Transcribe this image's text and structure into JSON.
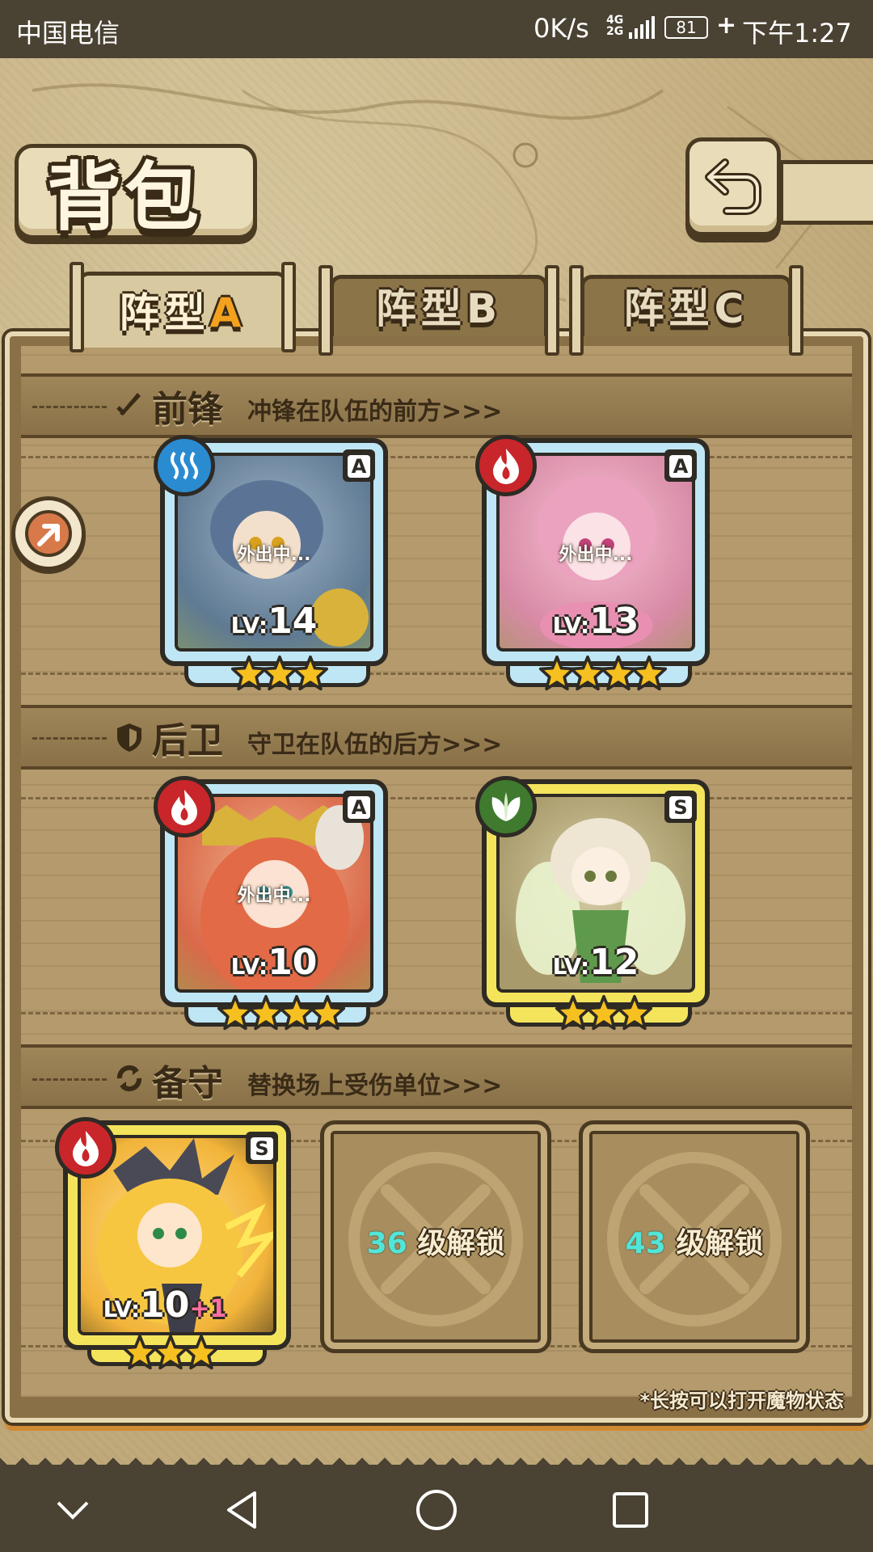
{
  "status_bar": {
    "carrier": "中国电信",
    "speed": "0K/s",
    "network": "4G\n2G",
    "battery": "81",
    "time": "下午1:27"
  },
  "header": {
    "title": "背包",
    "back_icon": "return-arrow-icon"
  },
  "tabs": [
    {
      "prefix": "阵型",
      "letter": "A",
      "active": true
    },
    {
      "prefix": "阵型",
      "letter": "B",
      "active": false
    },
    {
      "prefix": "阵型",
      "letter": "C",
      "active": false
    }
  ],
  "sections": {
    "front": {
      "title": "前锋",
      "subtitle": "冲锋在队伍的前方>>>",
      "icon": "sword-icon"
    },
    "back": {
      "title": "后卫",
      "subtitle": "守卫在队伍的后方>>>",
      "icon": "shield-icon"
    },
    "reserve": {
      "title": "备守",
      "subtitle": "替换场上受伤单位>>>",
      "icon": "swap-icon"
    }
  },
  "cards": {
    "front_1": {
      "element": "water",
      "rank": "A",
      "away": "外出中...",
      "lv_prefix": "LV:",
      "lv": "14",
      "stars": 3,
      "frame": "blue"
    },
    "front_2": {
      "element": "fire",
      "rank": "A",
      "away": "外出中...",
      "lv_prefix": "LV:",
      "lv": "13",
      "stars": 4,
      "frame": "blue"
    },
    "back_1": {
      "element": "fire",
      "rank": "A",
      "away": "外出中...",
      "lv_prefix": "LV:",
      "lv": "10",
      "stars": 4,
      "frame": "blue"
    },
    "back_2": {
      "element": "grass",
      "rank": "S",
      "lv_prefix": "LV:",
      "lv": "12",
      "stars": 3,
      "frame": "gold"
    },
    "reserve_1": {
      "element": "fire",
      "rank": "S",
      "lv_prefix": "LV:",
      "lv": "10",
      "lv_bonus": "+1",
      "stars": 3,
      "frame": "gold"
    }
  },
  "locked_slots": [
    {
      "level": "36",
      "text": "级解锁"
    },
    {
      "level": "43",
      "text": "级解锁"
    }
  ],
  "hint": "*长按可以打开魔物状态",
  "colors": {
    "accent_orange": "#f4a21e",
    "water": "#2a8bd1",
    "fire": "#c8262a",
    "grass": "#3f7a2e",
    "frame_blue": "#bfe6f4",
    "frame_gold": "#f4e45c",
    "unlock_level": "#51e6d8"
  }
}
